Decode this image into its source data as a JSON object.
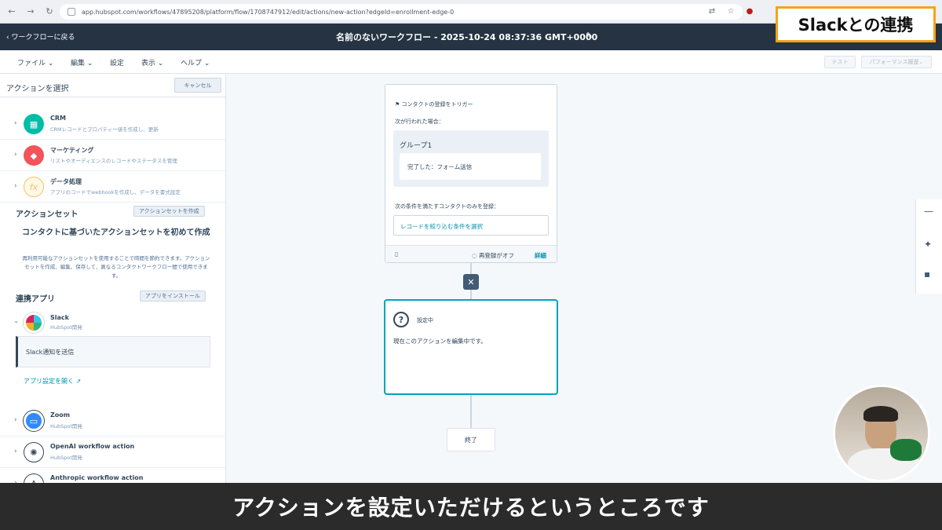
{
  "browser": {
    "url": "app.hubspot.com/workflows/47895208/platform/flow/1708747912/edit/actions/new-action?edgeId=enrollment-edge-0"
  },
  "header": {
    "back_label": "ワークフローに戻る",
    "workflow_title": "名前のないワークフロー - 2025-10-24 08:37:36 GMT+0000"
  },
  "badge": {
    "text": "Slackとの連携"
  },
  "menu": {
    "items": [
      "ファイル",
      "編集",
      "設定",
      "表示",
      "ヘルプ"
    ],
    "test_label": "テスト",
    "performance_label": "パフォーマンス履歴"
  },
  "panel": {
    "title": "アクションを選択",
    "cancel_label": "キャンセル",
    "categories": [
      {
        "name": "CRM",
        "desc": "CRMレコードとプロパティー値を作成し、更新"
      },
      {
        "name": "マーケティング",
        "desc": "リストやオーディエンスのレコードやステータスを管理"
      },
      {
        "name": "データ処理",
        "desc": "アプリのコードでwebhookを作成し、データを書式設定"
      }
    ],
    "action_set": {
      "label": "アクションセット",
      "create_label": "アクションセットを作成",
      "title": "コンタクトに基づいたアクションセットを初めて作成",
      "desc": "再利用可能なアクションセットを使用することで時間を節約できます。アクションセットを作成、編集、保存して、異なるコンタクトワークフロー間で使用できます。"
    },
    "apps": {
      "label": "連携アプリ",
      "install_label": "アプリをインストール",
      "slack_name": "Slack",
      "slack_by": "HubSpot開発",
      "slack_action": "Slack通知を送信",
      "open_settings": "アプリ設定を開く",
      "zoom_name": "Zoom",
      "zoom_by": "HubSpot開発",
      "openai_name": "OpenAI workflow action",
      "openai_by": "HubSpot開発",
      "anthropic_name": "Anthropic workflow action"
    }
  },
  "trigger": {
    "heading": "コンタクトの登録をトリガー",
    "when_label": "次が行われた場合：",
    "group_title": "グループ1",
    "condition": "完了した：フォーム送信",
    "filter_label": "次の条件を満たすコンタクトのみを登録：",
    "filter_button": "レコードを絞り込む条件を選択",
    "reenroll": "再登録がオフ",
    "detail": "詳細"
  },
  "action_card": {
    "status": "設定中",
    "message": "現在このアクションを編集中です。"
  },
  "end_label": "終了",
  "subtitle": "アクションを設定いただけるというところです"
}
